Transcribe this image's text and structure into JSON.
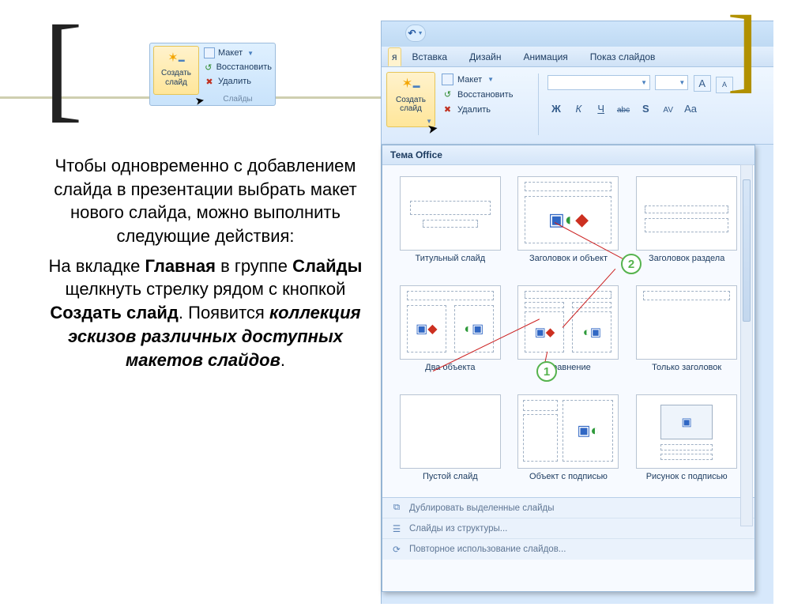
{
  "brackets": {
    "left": "[",
    "right": "]"
  },
  "paragraphs": {
    "p1_a": "Чтобы одновременно с добавлением слайда в презентации выбрать макет нового слайда, можно выполнить следующие действия:",
    "p2_a": "На вкладке ",
    "p2_b": "Главная",
    "p2_c": " в группе ",
    "p2_d": "Слайды",
    "p2_e": " щелкнуть стрелку рядом с кнопкой ",
    "p2_f": "Создать слайд",
    "p2_g": ". Появится ",
    "p2_h": "коллекция эскизов различных доступных макетов слайдов",
    "p2_i": "."
  },
  "small_ribbon": {
    "create1": "Создать",
    "create2": "слайд",
    "layout": "Макет",
    "restore": "Восстановить",
    "delete": "Удалить",
    "group": "Слайды"
  },
  "ppt": {
    "undo_glyph": "↶",
    "tabs": {
      "home_trunc": "я",
      "insert": "Вставка",
      "design": "Дизайн",
      "anim": "Анимация",
      "show": "Показ слайдов"
    },
    "ribbon": {
      "create1": "Создать",
      "create2": "слайд",
      "layout": "Макет",
      "restore": "Восстановить",
      "delete": "Удалить"
    },
    "fmt": {
      "bold": "Ж",
      "italic": "К",
      "under": "Ч",
      "strike": "abc",
      "shadow": "S",
      "spacing": "AV",
      "case": "Aa",
      "grow": "A",
      "shrink": "A"
    }
  },
  "gallery": {
    "header": "Тема Office",
    "items": [
      "Титульный слайд",
      "Заголовок и объект",
      "Заголовок раздела",
      "Два объекта",
      "Сравнение",
      "Только заголовок",
      "Пустой слайд",
      "Объект с подписью",
      "Рисунок с подписью"
    ],
    "callout1": "1",
    "callout2": "2",
    "footer": {
      "dup": "Дублировать выделенные слайды",
      "outline": "Слайды из структуры...",
      "reuse": "Повторное использование слайдов..."
    }
  }
}
